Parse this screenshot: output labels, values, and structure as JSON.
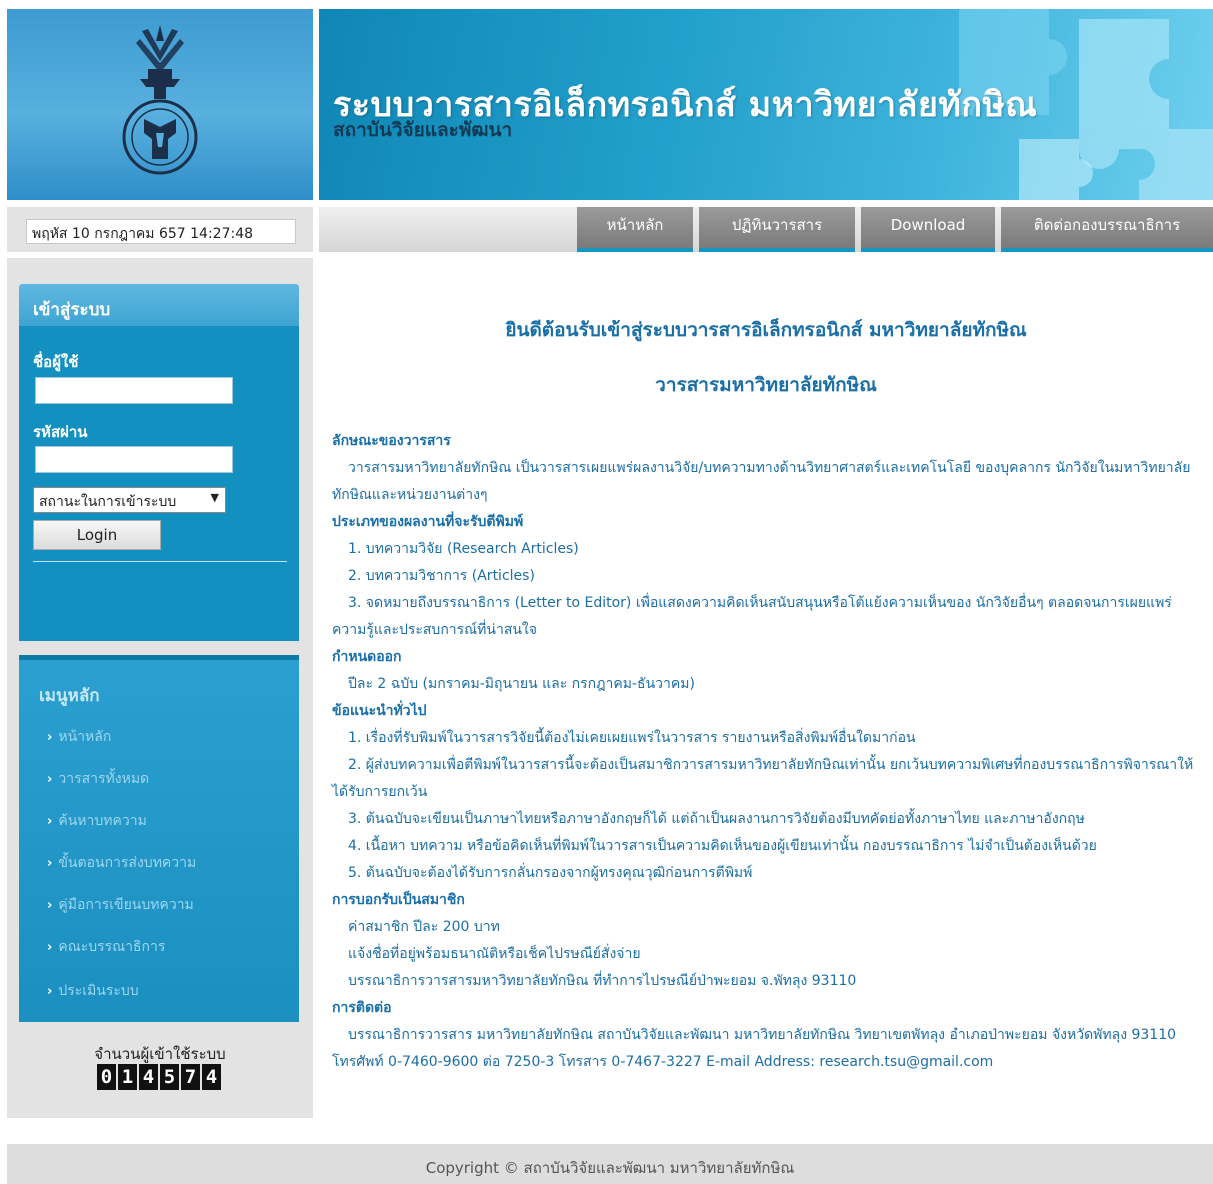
{
  "header": {
    "title": "ระบบวารสารอิเล็กทรอนิกส์ มหาวิทยาลัยทักษิณ",
    "subtitle": "สถาบันวิจัยและพัฒนา",
    "logo_icon": "university-seal-icon"
  },
  "datetime": "พฤหัส 10 กรกฎาคม 657 14:27:48",
  "nav": {
    "items": [
      {
        "label": "หน้าหลัก"
      },
      {
        "label": "ปฏิทินวารสาร"
      },
      {
        "label": "Download"
      },
      {
        "label": "ติดต่อกองบรรณาธิการ"
      }
    ]
  },
  "login": {
    "heading": "เข้าสู่ระบบ",
    "username_label": "ชื่อผู้ใช้",
    "password_label": "รหัสผ่าน",
    "status_select": "สถานะในการเข้าระบบ",
    "button": "Login"
  },
  "menu": {
    "heading": "เมนูหลัก",
    "items": [
      {
        "label": "หน้าหลัก"
      },
      {
        "label": "วารสารทั้งหมด"
      },
      {
        "label": "ค้นหาบทความ"
      },
      {
        "label": "ขั้นตอนการส่งบทความ"
      },
      {
        "label": "คู่มือการเขียนบทความ"
      },
      {
        "label": "คณะบรรณาธิการ"
      },
      {
        "label": "ประเมินระบบ"
      }
    ]
  },
  "counter": {
    "label": "จำนวนผู้เข้าใช้ระบบ",
    "digits": [
      "0",
      "1",
      "4",
      "5",
      "7",
      "4"
    ]
  },
  "main": {
    "welcome": "ยินดีต้อนรับเข้าสู่ระบบวารสารอิเล็กทรอนิกส์ มหาวิทยาลัยทักษิณ",
    "journal_name": "วารสารมหาวิทยาลัยทักษิณ",
    "sections": [
      {
        "heading": "ลักษณะของวารสาร",
        "lines": [
          "วารสารมหาวิทยาลัยทักษิณ เป็นวารสารเผยแพร่ผลงานวิจัย/บทความทางด้านวิทยาศาสตร์และเทคโนโลยี ของบุคลากร นักวิจัยในมหาวิทยาลัยทักษิณและหน่วยงานต่างๆ"
        ]
      },
      {
        "heading": "ประเภทของผลงานที่จะรับตีพิมพ์",
        "lines": [
          "1. บทความวิจัย (Research Articles)",
          "2. บทความวิชาการ (Articles)",
          "3. จดหมายถึงบรรณาธิการ (Letter to Editor) เพื่อแสดงความคิดเห็นสนับสนุนหรือโต้แย้งความเห็นของ นักวิจัยอื่นๆ ตลอดจนการเผยแพร่ความรู้และประสบการณ์ที่น่าสนใจ"
        ]
      },
      {
        "heading": "กำหนดออก",
        "lines": [
          "ปีละ 2 ฉบับ (มกราคม-มิถุนายน และ กรกฎาคม-ธันวาคม)"
        ]
      },
      {
        "heading": "ข้อแนะนำทั่วไป",
        "lines": [
          "1. เรื่องที่รับพิมพ์ในวารสารวิจัยนี้ต้องไม่เคยเผยแพร่ในวารสาร รายงานหรือสิ่งพิมพ์อื่นใดมาก่อน",
          "2. ผู้ส่งบทความเพื่อตีพิมพ์ในวารสารนี้จะต้องเป็นสมาชิกวารสารมหาวิทยาลัยทักษิณเท่านั้น ยกเว้นบทความพิเศษที่กองบรรณาธิการพิจารณาให้ได้รับการยกเว้น",
          "3. ต้นฉบับจะเขียนเป็นภาษาไทยหรือภาษาอังกฤษก็ได้ แต่ถ้าเป็นผลงานการวิจัยต้องมีบทคัดย่อทั้งภาษาไทย และภาษาอังกฤษ",
          "4. เนื้อหา บทความ หรือข้อคิดเห็นที่พิมพ์ในวารสารเป็นความคิดเห็นของผู้เขียนเท่านั้น กองบรรณาธิการ ไม่จำเป็นต้องเห็นด้วย",
          "5. ต้นฉบับจะต้องได้รับการกลั่นกรองจากผู้ทรงคุณวุฒิก่อนการตีพิมพ์"
        ]
      },
      {
        "heading": "การบอกรับเป็นสมาชิก",
        "lines": [
          "ค่าสมาชิก ปีละ 200 บาท",
          "แจ้งชื่อที่อยู่พร้อมธนาณัติหรือเช็คไปรษณีย์สั่งจ่าย",
          "บรรณาธิการวารสารมหาวิทยาลัยทักษิณ ที่ทำการไปรษณีย์ป่าพะยอม จ.พัทลุง 93110"
        ]
      },
      {
        "heading": "การติดต่อ",
        "lines": [
          "บรรณาธิการวารสาร มหาวิทยาลัยทักษิณ สถาบันวิจัยและพัฒนา มหาวิทยาลัยทักษิณ วิทยาเขตพัทลุง อำเภอป่าพะยอม จังหวัดพัทลุง 93110 โทรศัพท์ 0-7460-9600 ต่อ 7250-3 โทรสาร 0-7467-3227 E-mail Address: research.tsu@gmail.com"
        ]
      }
    ]
  },
  "footer": "Copyright © สถาบันวิจัยและพัฒนา มหาวิทยาลัยทักษิณ",
  "colors": {
    "accent": "#1796c4",
    "link": "#1a6fa8",
    "menu_text": "#9dd7f2"
  }
}
